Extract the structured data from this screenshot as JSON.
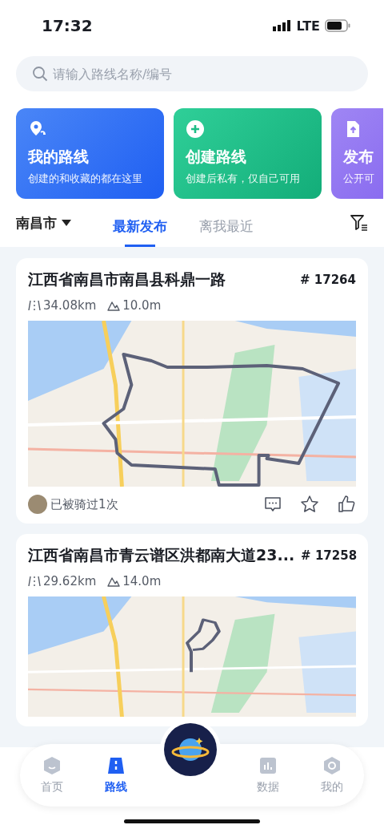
{
  "status_bar": {
    "time": "17:32",
    "network": "LTE"
  },
  "search": {
    "placeholder": "请输入路线名称/编号"
  },
  "feature_cards": [
    {
      "kind": "mine",
      "title": "我的路线",
      "subtitle": "创建的和收藏的都在这里"
    },
    {
      "kind": "create",
      "title": "创建路线",
      "subtitle": "创建后私有，仅自己可用"
    },
    {
      "kind": "publish",
      "title": "发布",
      "subtitle": "公开可"
    }
  ],
  "city": "南昌市",
  "tabs": [
    {
      "label": "最新发布",
      "selected": true
    },
    {
      "label": "离我最近",
      "selected": false
    }
  ],
  "routes": [
    {
      "title": "江西省南昌市南昌县科鼎一路",
      "number": "# 17264",
      "distance": "34.08km",
      "elevation": "10.0m",
      "ridden": "已被骑过1次"
    },
    {
      "title": "江西省南昌市青云谱区洪都南大道23...",
      "number": "# 17258",
      "distance": "29.62km",
      "elevation": "14.0m"
    }
  ],
  "nav": [
    {
      "kind": "home",
      "label": "首页",
      "selected": false
    },
    {
      "kind": "route",
      "label": "路线",
      "selected": true
    },
    {
      "kind": "data",
      "label": "数据",
      "selected": false
    },
    {
      "kind": "me",
      "label": "我的",
      "selected": false
    }
  ]
}
